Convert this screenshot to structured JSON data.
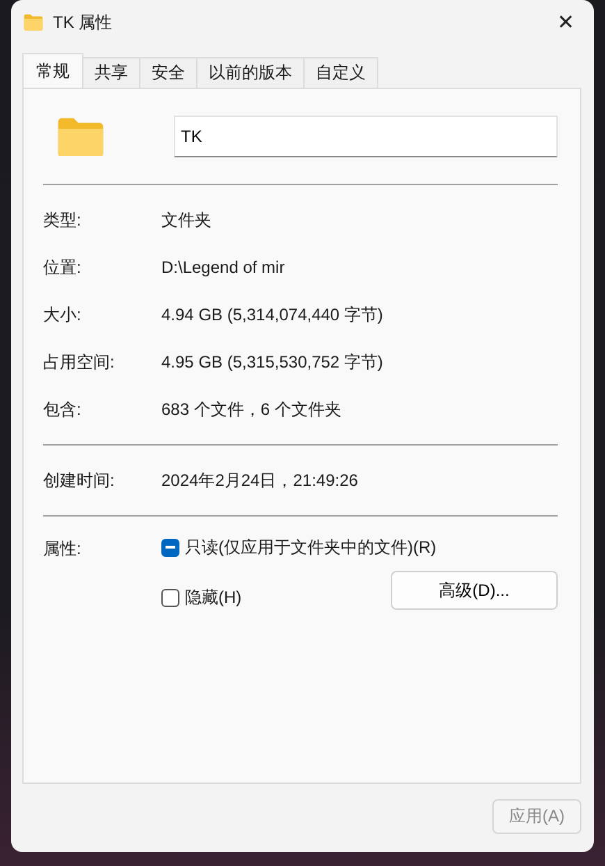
{
  "window": {
    "title": "TK 属性",
    "close": "✕"
  },
  "tabs": [
    {
      "label": "常规",
      "selected": true
    },
    {
      "label": "共享",
      "selected": false
    },
    {
      "label": "安全",
      "selected": false
    },
    {
      "label": "以前的版本",
      "selected": false
    },
    {
      "label": "自定义",
      "selected": false
    }
  ],
  "name_field": {
    "value": "TK"
  },
  "groups": [
    [
      {
        "label": "类型:",
        "value": "文件夹"
      },
      {
        "label": "位置:",
        "value": "D:\\Legend of mir"
      },
      {
        "label": "大小:",
        "value": "4.94 GB (5,314,074,440 字节)"
      },
      {
        "label": "占用空间:",
        "value": "4.95 GB (5,315,530,752 字节)"
      },
      {
        "label": "包含:",
        "value": "683 个文件，6 个文件夹"
      }
    ],
    [
      {
        "label": "创建时间:",
        "value": "2024年2月24日，21:49:26"
      }
    ]
  ],
  "attributes": {
    "label": "属性:",
    "options": [
      {
        "label": "只读(仅应用于文件夹中的文件)(R)",
        "checked": true,
        "indeterminate": true
      },
      {
        "label": "隐藏(H)",
        "checked": false,
        "indeterminate": false
      }
    ],
    "advanced_button": "高级(D)..."
  },
  "buttons": [
    {
      "label": "应用(A)",
      "disabled": true
    }
  ]
}
